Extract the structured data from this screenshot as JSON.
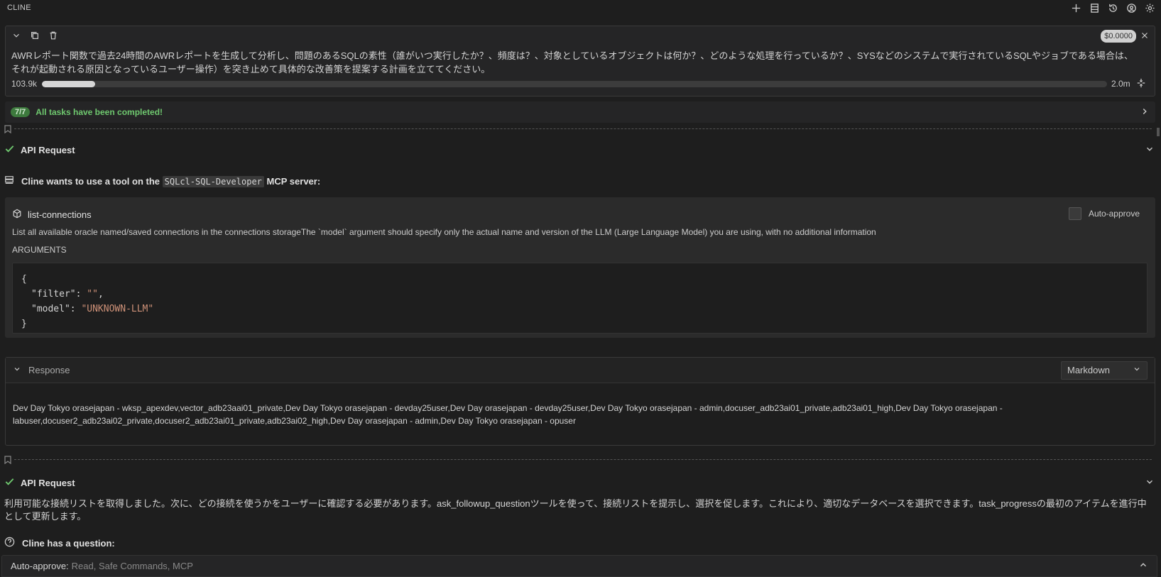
{
  "app": {
    "title": "CLINE"
  },
  "toolbar": {
    "icons": [
      "plus-icon",
      "history-list-icon",
      "history-icon",
      "account-icon",
      "gear-icon"
    ]
  },
  "task": {
    "cost": "$0.0000",
    "text": "AWRレポート関数で過去24時間のAWRレポートを生成して分析し、問題のあるSQLの素性（誰がいつ実行したか？、頻度は？、対象としているオブジェクトは何か？、どのような処理を行っているか？、SYSなどのシステムで実行されているSQLやジョブである場合は、それが起動される原因となっているユーザー操作）を突き止めて具体的な改善策を提案する計画を立ててください。",
    "tokens_used": "103.9k",
    "tokens_max": "2.0m",
    "context_fraction": 0.05
  },
  "tasks_progress": {
    "count": "7/7",
    "label": "All tasks have been completed!"
  },
  "api_request_1": {
    "label": "API Request"
  },
  "mcp": {
    "prefix": "Cline wants to use a tool on the",
    "server": "SQLcl-SQL-Developer",
    "suffix": "MCP server:"
  },
  "tool": {
    "name": "list-connections",
    "auto_approve_label": "Auto-approve",
    "description": "List all available oracle named/saved connections in the connections storageThe `model` argument should specify only the actual name and version of the LLM (Large Language Model) you are using, with no additional information",
    "arguments_label": "ARGUMENTS",
    "args": {
      "open": "{",
      "filter_key": "\"filter\"",
      "filter_val": "\"\"",
      "model_key": "\"model\"",
      "model_val": "\"UNKNOWN-LLM\"",
      "close": "}"
    }
  },
  "response": {
    "title": "Response",
    "format": "Markdown",
    "body": "Dev Day Tokyo orasejapan - wksp_apexdev,vector_adb23aai01_private,Dev Day Tokyo orasejapan - devday25user,Dev Day orasejapan - devday25user,Dev Day Tokyo orasejapan - admin,docuser_adb23ai01_private,adb23ai01_high,Dev Day Tokyo orasejapan - labuser,docuser2_adb23ai02_private,docuser2_adb23ai01_private,adb23ai02_high,Dev Day orasejapan - admin,Dev Day Tokyo orasejapan - opuser"
  },
  "api_request_2": {
    "label": "API Request"
  },
  "followup": {
    "text": "利用可能な接続リストを取得しました。次に、どの接続を使うかをユーザーに確認する必要があります。ask_followup_questionツールを使って、接続リストを提示し、選択を促します。これにより、適切なデータベースを選択できます。task_progressの最初のアイテムを進行中として更新します。"
  },
  "question": {
    "label": "Cline has a question:"
  },
  "auto_approve_bar": {
    "label": "Auto-approve:",
    "value": "Read, Safe Commands, MCP"
  }
}
